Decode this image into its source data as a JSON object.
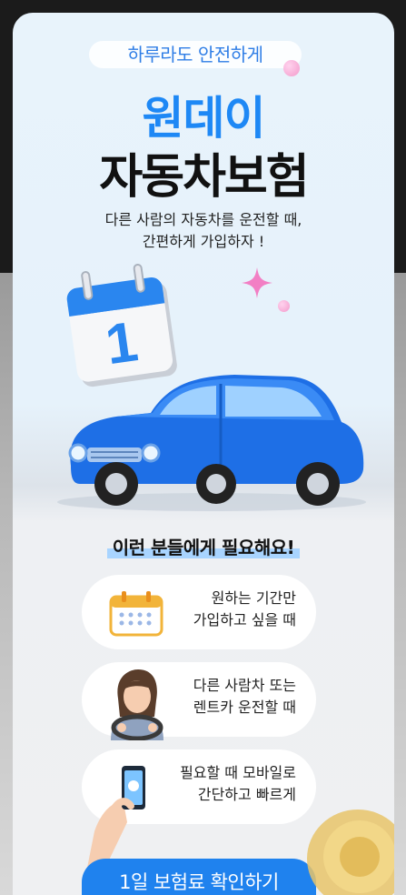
{
  "header": {
    "tagline": "하루라도 안전하게",
    "title_line1": "원데이",
    "title_line2": "자동차보험",
    "subtitle_line1": "다른 사람의 자동차를 운전할 때,",
    "subtitle_line2": "간편하게 가입하자 !"
  },
  "hero": {
    "calendar_day": "1",
    "icons": [
      "calendar-icon",
      "car-icon",
      "sparkle-icon"
    ]
  },
  "section": {
    "title": "이런 분들에게 필요해요!"
  },
  "cards": [
    {
      "line1": "원하는 기간만",
      "line2": "가입하고 싶을 때",
      "icon": "calendar-icon"
    },
    {
      "line1": "다른 사람차 또는",
      "line2": "렌트카 운전할 때",
      "icon": "driver-icon"
    },
    {
      "line1": "필요할 때 모바일로",
      "line2": "간단하고 빠르게",
      "icon": "mobile-phone-icon"
    }
  ],
  "cta": {
    "label": "1일 보험료 확인하기"
  },
  "colors": {
    "accent": "#1e88f5",
    "button": "#1f82ee",
    "background": "#e8f3fb"
  }
}
